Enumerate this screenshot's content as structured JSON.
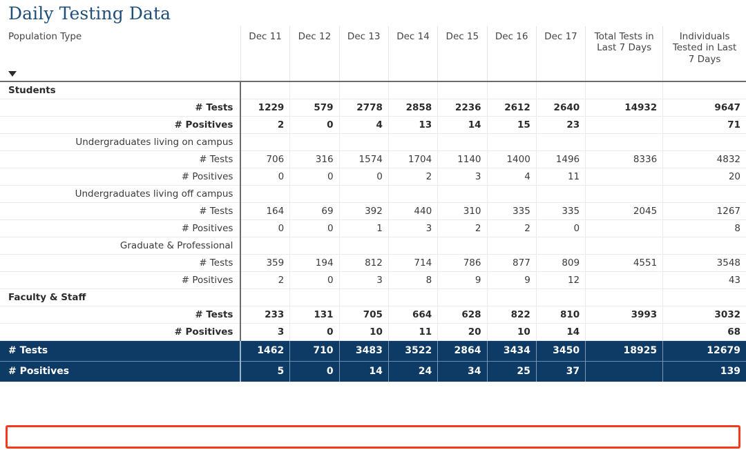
{
  "title": "Daily Testing Data",
  "table": {
    "label_header": "Population Type",
    "sort_indicator": "sort-descending-arrow",
    "columns": [
      "Dec 11",
      "Dec 12",
      "Dec 13",
      "Dec 14",
      "Dec 15",
      "Dec 16",
      "Dec 17",
      "Total Tests in Last 7 Days",
      "Individuals Tested in Last 7 Days"
    ],
    "rows": [
      {
        "label": "Students",
        "level": "section",
        "values": [
          "",
          "",
          "",
          "",
          "",
          "",
          "",
          "",
          ""
        ]
      },
      {
        "label": "# Tests",
        "level": "lvl1",
        "values": [
          "1229",
          "579",
          "2778",
          "2858",
          "2236",
          "2612",
          "2640",
          "14932",
          "9647"
        ]
      },
      {
        "label": "# Positives",
        "level": "lvl1",
        "values": [
          "2",
          "0",
          "4",
          "13",
          "14",
          "15",
          "23",
          "",
          "71"
        ]
      },
      {
        "label": "Undergraduates living on campus",
        "level": "lvl2",
        "values": [
          "",
          "",
          "",
          "",
          "",
          "",
          "",
          "",
          ""
        ]
      },
      {
        "label": "# Tests",
        "level": "lvl3",
        "values": [
          "706",
          "316",
          "1574",
          "1704",
          "1140",
          "1400",
          "1496",
          "8336",
          "4832"
        ]
      },
      {
        "label": "# Positives",
        "level": "lvl3",
        "values": [
          "0",
          "0",
          "0",
          "2",
          "3",
          "4",
          "11",
          "",
          "20"
        ]
      },
      {
        "label": "Undergraduates living off campus",
        "level": "lvl2",
        "values": [
          "",
          "",
          "",
          "",
          "",
          "",
          "",
          "",
          ""
        ]
      },
      {
        "label": "# Tests",
        "level": "lvl3",
        "values": [
          "164",
          "69",
          "392",
          "440",
          "310",
          "335",
          "335",
          "2045",
          "1267"
        ]
      },
      {
        "label": "# Positives",
        "level": "lvl3",
        "values": [
          "0",
          "0",
          "1",
          "3",
          "2",
          "2",
          "0",
          "",
          "8"
        ]
      },
      {
        "label": "Graduate & Professional",
        "level": "lvl2",
        "values": [
          "",
          "",
          "",
          "",
          "",
          "",
          "",
          "",
          ""
        ]
      },
      {
        "label": "# Tests",
        "level": "lvl3",
        "values": [
          "359",
          "194",
          "812",
          "714",
          "786",
          "877",
          "809",
          "4551",
          "3548"
        ]
      },
      {
        "label": "# Positives",
        "level": "lvl3",
        "values": [
          "2",
          "0",
          "3",
          "8",
          "9",
          "9",
          "12",
          "",
          "43"
        ]
      },
      {
        "label": "Faculty & Staff",
        "level": "section",
        "values": [
          "",
          "",
          "",
          "",
          "",
          "",
          "",
          "",
          ""
        ]
      },
      {
        "label": "# Tests",
        "level": "lvl1",
        "values": [
          "233",
          "131",
          "705",
          "664",
          "628",
          "822",
          "810",
          "3993",
          "3032"
        ]
      },
      {
        "label": "# Positives",
        "level": "lvl1",
        "values": [
          "3",
          "0",
          "10",
          "11",
          "20",
          "10",
          "14",
          "",
          "68"
        ]
      },
      {
        "label": "# Tests",
        "level": "grand grand-first",
        "values": [
          "1462",
          "710",
          "3483",
          "3522",
          "2864",
          "3434",
          "3450",
          "18925",
          "12679"
        ]
      },
      {
        "label": "# Positives",
        "level": "grand",
        "values": [
          "5",
          "0",
          "14",
          "24",
          "34",
          "25",
          "37",
          "",
          "139"
        ]
      }
    ]
  },
  "highlight": {
    "name": "positives-total-highlight",
    "color": "#f4391c"
  },
  "colors": {
    "title": "#1f4e79",
    "grand_total_row": "#0d3b66",
    "highlight": "#f4391c"
  }
}
